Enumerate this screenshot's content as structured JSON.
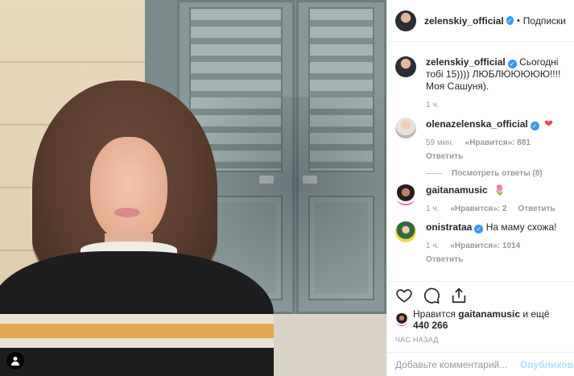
{
  "header": {
    "username": "zelenskiy_official",
    "separator": "•",
    "follow_label": "Подписки"
  },
  "comments": [
    {
      "username": "zelenskiy_official",
      "text": "Сьогодні тобі 15)))) ЛЮБЛЮЮЮЮЮ!!!! Моя Сашуня).",
      "time": "1 ч."
    },
    {
      "username": "olenazelenska_official",
      "text": "❤",
      "time": "59 мин.",
      "likes": "«Нравится»: 881",
      "reply": "Ответить",
      "replies_label": "Посмотреть ответы (8)"
    },
    {
      "username": "gaitanamusic",
      "text": "🌷",
      "time": "1 ч.",
      "likes": "«Нравится»: 2",
      "reply": "Ответить"
    },
    {
      "username": "onistrataa",
      "text": "На маму схожа!",
      "time": "1 ч.",
      "likes": "«Нравится»: 1014",
      "reply": "Ответить"
    }
  ],
  "likes_line": {
    "prefix": "Нравится",
    "user": "gaitanamusic",
    "middle": "и ещё",
    "count": "440 266"
  },
  "posted_time": "ЧАС НАЗАД",
  "comment_box": {
    "placeholder": "Добавьте комментарий...",
    "publish_label": "Опубликовать"
  },
  "icons": [
    "heart-icon",
    "comment-icon",
    "share-icon",
    "user-tag-icon",
    "verified-icon"
  ],
  "colors": {
    "verified": "#3897f0",
    "heart": "#ed4956",
    "publish": "#b2dffc",
    "muted": "#999999"
  }
}
